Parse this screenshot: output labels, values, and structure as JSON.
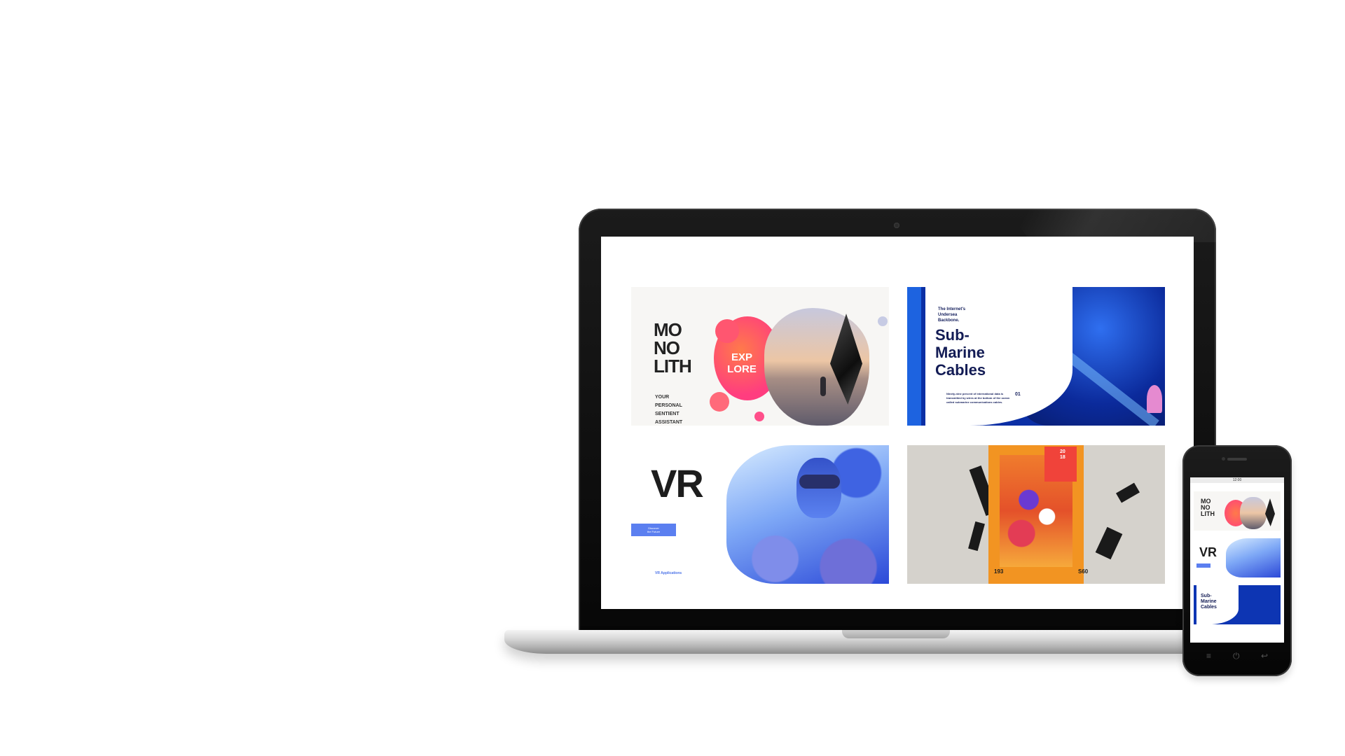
{
  "laptop": {
    "tiles": [
      {
        "name": "monolith",
        "title": "MO\nNO\nLITH",
        "subtitle": "YOUR\nPERSONAL\nSENTIENT\nASSISTANT",
        "badge": "EXP\nLORE"
      },
      {
        "name": "submarine-cables",
        "kicker": "The Internet's\nUndersea\nBackbone.",
        "title": "Sub-\nMarine\nCables",
        "body": "Ninety-nine percent of international data is transmitted by wires at the bottom of the ocean called submarine communications cables.",
        "number": "01"
      },
      {
        "name": "vr",
        "title": "VR",
        "button": "Discover\nthe Future",
        "link": "VR Applications"
      },
      {
        "name": "poster-art",
        "year": "20\n18",
        "number_left": "193",
        "number_right": "S60"
      }
    ]
  },
  "phone": {
    "status_time": "12:00",
    "tiles": {
      "monolith": "MO\nNO\nLITH",
      "vr": "VR",
      "submarine": "Sub-\nMarine\nCables"
    },
    "nav": {
      "menu_icon": "≡",
      "home_icon": "⏻",
      "back_icon": "↩"
    }
  }
}
